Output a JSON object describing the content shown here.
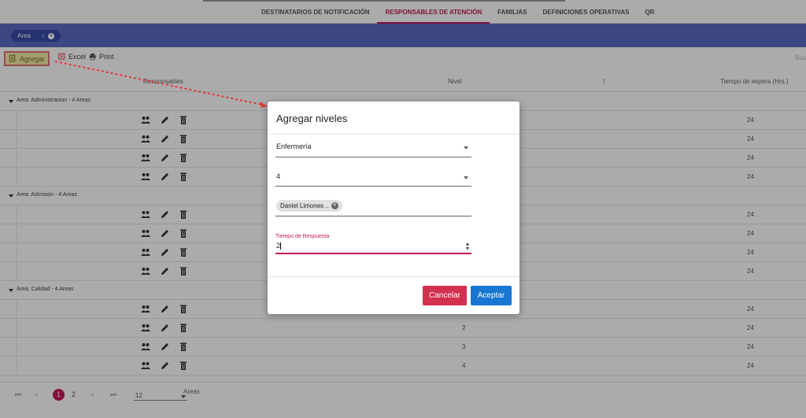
{
  "tabs": [
    {
      "label": "DESTINATARIOS DE NOTIFICACIÓN",
      "active": false
    },
    {
      "label": "RESPONSABLES DE ATENCIÓN",
      "active": true
    },
    {
      "label": "FAMILIAS",
      "active": false
    },
    {
      "label": "DEFINICIONES OPERATIVAS",
      "active": false
    },
    {
      "label": "QR",
      "active": false
    }
  ],
  "group_chip": {
    "label": "Area",
    "sort_arrow": "↑"
  },
  "toolbar": {
    "agregar": "Agregar",
    "excel": "Excel",
    "print": "Print",
    "buscar": "Bus"
  },
  "columns": {
    "responsables": "Responsables",
    "nivel": "Nivel",
    "extra": "I",
    "tiempo": "Tiempo de espera (Hrs.)"
  },
  "groups": [
    {
      "label": "Area: Administracion - 4 Areas",
      "rows": [
        {
          "nivel": "",
          "tiempo": "24"
        },
        {
          "nivel": "",
          "tiempo": "24"
        },
        {
          "nivel": "",
          "tiempo": "24"
        },
        {
          "nivel": "",
          "tiempo": "24"
        }
      ]
    },
    {
      "label": "Area: Admisión - 4 Areas",
      "rows": [
        {
          "nivel": "",
          "tiempo": "24"
        },
        {
          "nivel": "",
          "tiempo": "24"
        },
        {
          "nivel": "",
          "tiempo": "24"
        },
        {
          "nivel": "",
          "tiempo": "24"
        }
      ]
    },
    {
      "label": "Area: Calidad - 4 Areas",
      "rows": [
        {
          "nivel": "",
          "tiempo": "24"
        },
        {
          "nivel": "2",
          "tiempo": "24"
        },
        {
          "nivel": "3",
          "tiempo": "24"
        },
        {
          "nivel": "4",
          "tiempo": "24"
        }
      ]
    }
  ],
  "pager": {
    "first": "⏮",
    "prev": "‹",
    "current": "1",
    "next_page": "2",
    "next": "›",
    "last": "⏭",
    "page_size": "12",
    "label": "Areas"
  },
  "modal": {
    "title": "Agregar niveles",
    "area_value": "Enfermería",
    "nivel_value": "4",
    "responsable_chip": "Daniel Limones ..",
    "tiempo_label": "Tiempo de Respuesta",
    "tiempo_value": "2",
    "cancel_label": "Cancelar",
    "ok_label": "Aceptar"
  },
  "colors": {
    "accent": "#c2185b",
    "groupbar": "#5c6bc0",
    "cancel": "#d32f4f",
    "accept": "#1976d2",
    "annotation": "#e53935"
  }
}
